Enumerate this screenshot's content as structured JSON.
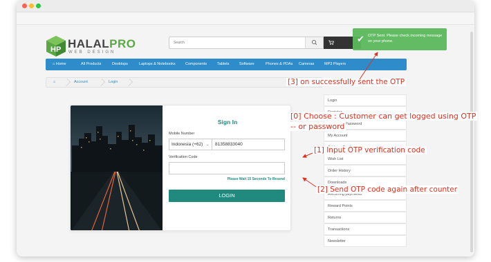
{
  "window": {
    "controls": [
      "close",
      "minimize",
      "zoom"
    ]
  },
  "logo": {
    "name_main": "HALAL",
    "name_accent": "PRO",
    "subtitle": "WEB DESIGN"
  },
  "search": {
    "placeholder": "Search"
  },
  "toast": {
    "message": "OTP Sent. Please check incoming message on your phone."
  },
  "nav": {
    "items": [
      "Home",
      "All Products",
      "Desktops",
      "Laptops & Notebooks",
      "Components",
      "Tablets",
      "Software",
      "Phones & PDAs",
      "Cameras",
      "MP3 Players"
    ]
  },
  "breadcrumb": {
    "items": [
      "Account",
      "Login"
    ]
  },
  "login_form": {
    "title": "Sign In",
    "mobile_label": "Mobile Number",
    "country": "Indonesia (+62)",
    "phone": "81358833040",
    "code_label": "Verification Code",
    "code_value": "",
    "resend_text": "Please Wait 15 Seconds To Resend",
    "login_button": "LOGIN"
  },
  "sidebar": {
    "items": [
      "Login",
      "Register",
      "Forgotten Password",
      "My Account",
      "Address Book",
      "Wish List",
      "Order History",
      "Downloads",
      "Recurring payments",
      "Reward Points",
      "Returns",
      "Transactions",
      "Newsletter"
    ]
  },
  "annotations": {
    "a0_line1": "[0] Choose : Customer can get logged using OTP",
    "a0_line2": "-- or password",
    "a1": "[1] Input OTP verification code",
    "a2": "[2] Send OTP code again after counter",
    "a3": "[3] on successfully sent the OTP"
  },
  "colors": {
    "nav_blue": "#2d8cc9",
    "teal": "#1f8a7d",
    "toast_green": "#5cb85c",
    "annotation_red": "#e0301e",
    "logo_green": "#5aa845"
  }
}
